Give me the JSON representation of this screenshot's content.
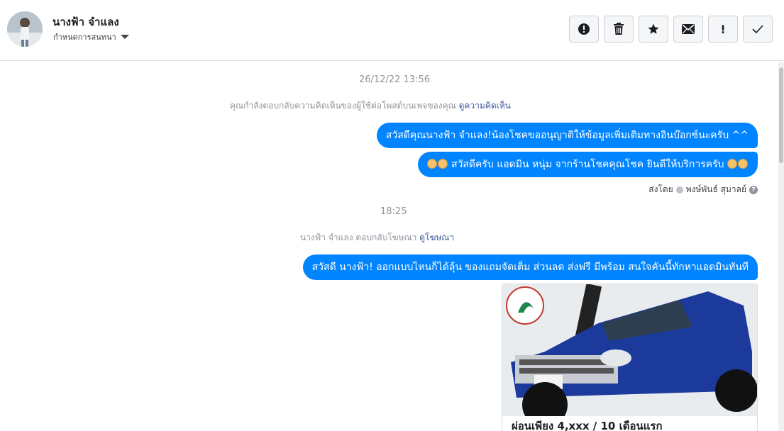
{
  "header": {
    "contact_name": "นางฟ้า จำแลง",
    "assign_label": "กำหนดการสนทนา",
    "actions": [
      "report-icon",
      "trash-icon",
      "star-icon",
      "envelope-icon",
      "exclamation-icon",
      "check-icon"
    ],
    "exclamation_glyph": "!"
  },
  "thread": {
    "timestamp_1": "26/12/22 13:56",
    "note_1_text": "คุณกำลังตอบกลับความคิดเห็นของผู้ใช้ต่อโพสต์บนเพจของคุณ",
    "note_1_link": "ดูความคิดเห็น",
    "message_1": "สวัสดีคุณนางฟ้า จำแลง!น้องโชคขออนุญาติให้ข้อมูลเพิ่มเติมทางอินบ๊อกซ์นะครับ ^^",
    "message_2": "สวัสดีครับ แอดมิน หนุ่ม จากร้านโชคคุณโชค ยินดีให้บริการครับ",
    "sent_by_label": "ส่งโดย",
    "sent_by_name": "พงษ์พันธ์ สุมาลย์",
    "timestamp_2": "18:25",
    "note_2_text": "นางฟ้า จำแลง ตอบกลับโฆษณา",
    "note_2_link": "ดูโฆษณา",
    "message_3": "สวัสดี นางฟ้า! ออกแบบไหนก็ได้ลุ้น ของแถมจัดเต็ม ส่วนลด ส่งฟรี มีพร้อม สนใจคันนี้ทักหาแอดมินทันที",
    "card_caption": "ผ่อนเพียง 4,xxx / 10 เดือนแรก"
  },
  "colors": {
    "bubble": "#0084ff",
    "link": "#3b5998",
    "meta": "#90949c"
  }
}
